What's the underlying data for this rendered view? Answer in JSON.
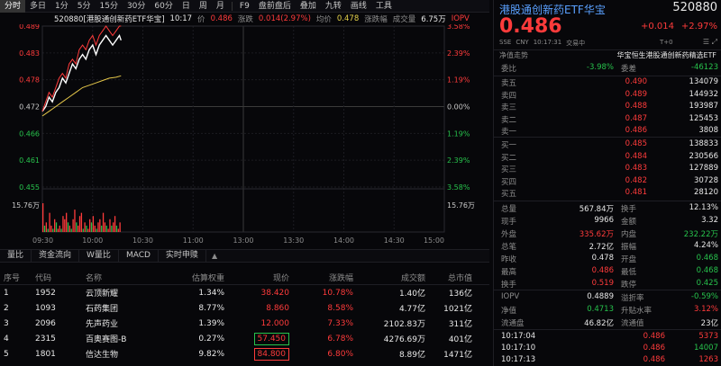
{
  "periods": [
    "分时",
    "多日",
    "1分",
    "5分",
    "15分",
    "30分",
    "60分",
    "日",
    "周",
    "月",
    "F9",
    "盘前盘后",
    "叠加",
    "九转",
    "画线",
    "工具"
  ],
  "info": {
    "code_name": "520880[港股通创新药ETF华宝]",
    "time": "10:17",
    "price_label": "价",
    "price": "0.486",
    "change_label": "涨跌",
    "change": "0.014(2.97%)",
    "avg_label": "均价",
    "avg": "0.478",
    "pct_label": "涨跌幅",
    "vol_label": "成交量",
    "volume": "6.75万",
    "iopv_label": "IOPV"
  },
  "chart": {
    "price_ticks": [
      "0.489",
      "0.483",
      "0.478",
      "0.472",
      "0.466",
      "0.461",
      "0.455"
    ],
    "pct_ticks": [
      "3.58%",
      "2.39%",
      "1.19%",
      "0.00%",
      "1.19%",
      "2.39%",
      "3.58%"
    ],
    "vol_ticks": [
      "15.76万",
      "15.76万"
    ],
    "time_ticks": [
      "09:30",
      "10:00",
      "10:30",
      "11:00",
      "13:00",
      "13:30",
      "14:00",
      "14:30",
      "15:00"
    ]
  },
  "chart_data": {
    "type": "line",
    "ylim": [
      0.455,
      0.489
    ],
    "series": [
      {
        "name": "价",
        "x": [
          0,
          2,
          4,
          6,
          8,
          10,
          12,
          14,
          16,
          18,
          20,
          22,
          24,
          26,
          28,
          30,
          32,
          34,
          36,
          38,
          40,
          42,
          44,
          46,
          47
        ],
        "values": [
          0.471,
          0.472,
          0.474,
          0.473,
          0.475,
          0.476,
          0.478,
          0.477,
          0.479,
          0.481,
          0.48,
          0.482,
          0.483,
          0.482,
          0.484,
          0.485,
          0.483,
          0.485,
          0.486,
          0.487,
          0.486,
          0.485,
          0.486,
          0.487,
          0.486
        ]
      },
      {
        "name": "均价",
        "x": [
          0,
          4,
          8,
          12,
          16,
          20,
          24,
          28,
          32,
          36,
          40,
          44,
          47
        ],
        "values": [
          0.47,
          0.471,
          0.472,
          0.473,
          0.474,
          0.475,
          0.476,
          0.4765,
          0.477,
          0.4775,
          0.478,
          0.4782,
          0.4785
        ]
      },
      {
        "name": "IOPV",
        "x": [
          0,
          2,
          4,
          6,
          8,
          10,
          12,
          14,
          16,
          18,
          20,
          22,
          24,
          26,
          28,
          30,
          32,
          34,
          36,
          38,
          40,
          42,
          44,
          46,
          47
        ],
        "values": [
          0.471,
          0.473,
          0.475,
          0.474,
          0.476,
          0.478,
          0.479,
          0.478,
          0.481,
          0.482,
          0.481,
          0.484,
          0.485,
          0.484,
          0.486,
          0.487,
          0.485,
          0.487,
          0.488,
          0.489,
          0.488,
          0.487,
          0.488,
          0.489,
          0.489
        ]
      }
    ],
    "volume": [
      9,
      2,
      3,
      1,
      6,
      2,
      1,
      4,
      3,
      1,
      2,
      1,
      5,
      4,
      6,
      3,
      2,
      1,
      4,
      7,
      3,
      2,
      5,
      6,
      1,
      3,
      2,
      1,
      4,
      3,
      5,
      2,
      1,
      3,
      4,
      2,
      6,
      3,
      2,
      1,
      4,
      2,
      3,
      5,
      2,
      1,
      3
    ],
    "volume_colors": [
      "r",
      "g",
      "r",
      "g",
      "r",
      "r",
      "g",
      "r",
      "g",
      "r",
      "r",
      "g",
      "r",
      "r",
      "r",
      "g",
      "r",
      "g",
      "r",
      "r",
      "g",
      "r",
      "r",
      "r",
      "g",
      "r",
      "g",
      "r",
      "r",
      "g",
      "r",
      "r",
      "g",
      "r",
      "r",
      "g",
      "r",
      "r",
      "g",
      "r",
      "r",
      "g",
      "r",
      "r",
      "g",
      "r",
      "r"
    ]
  },
  "tabs": [
    "量比",
    "资金流向",
    "W量比",
    "MACD",
    "实时申赎"
  ],
  "table": {
    "headers": [
      "序号",
      "代码",
      "名称",
      "估算权重",
      "现价",
      "涨跌幅",
      "成交额",
      "总市值"
    ],
    "rows": [
      {
        "idx": "1",
        "code": "1952",
        "name": "云顶新耀",
        "weight": "1.34%",
        "price": "38.420",
        "pct": "10.78%",
        "amount": "1.40亿",
        "cap": "136亿",
        "box": ""
      },
      {
        "idx": "2",
        "code": "1093",
        "name": "石药集团",
        "weight": "8.77%",
        "price": "8.860",
        "pct": "8.58%",
        "amount": "4.77亿",
        "cap": "1021亿",
        "box": ""
      },
      {
        "idx": "3",
        "code": "2096",
        "name": "先声药业",
        "weight": "1.39%",
        "price": "12.000",
        "pct": "7.33%",
        "amount": "2102.83万",
        "cap": "311亿",
        "box": ""
      },
      {
        "idx": "4",
        "code": "2315",
        "name": "百奥赛图-B",
        "weight": "0.27%",
        "price": "57.450",
        "pct": "6.78%",
        "amount": "4276.69万",
        "cap": "401亿",
        "box": "g"
      },
      {
        "idx": "5",
        "code": "1801",
        "name": "信达生物",
        "weight": "9.82%",
        "price": "84.800",
        "pct": "6.80%",
        "amount": "8.89亿",
        "cap": "1471亿",
        "box": "r"
      }
    ]
  },
  "panel": {
    "title": "港股通创新药ETF华宝",
    "code": "520880",
    "price": "0.486",
    "change": "+0.014",
    "pct": "+2.97%",
    "exchange": "SSE",
    "currency": "CNY",
    "time": "10:17:31",
    "status": "交易中",
    "t0": "T+0",
    "nav_label": "净值走势",
    "index_name": "华宝恒生港股通创新药精选ETF",
    "weibi_label": "委比",
    "weibi": "-3.98%",
    "weicha_label": "委差",
    "weicha": "-46123",
    "asks": [
      {
        "label": "卖五",
        "price": "0.490",
        "vol": "134079"
      },
      {
        "label": "卖四",
        "price": "0.489",
        "vol": "144932"
      },
      {
        "label": "卖三",
        "price": "0.488",
        "vol": "193987"
      },
      {
        "label": "卖二",
        "price": "0.487",
        "vol": "125453"
      },
      {
        "label": "卖一",
        "price": "0.486",
        "vol": "3808"
      }
    ],
    "bids": [
      {
        "label": "买一",
        "price": "0.485",
        "vol": "138833"
      },
      {
        "label": "买二",
        "price": "0.484",
        "vol": "230566"
      },
      {
        "label": "买三",
        "price": "0.483",
        "vol": "127889"
      },
      {
        "label": "买四",
        "price": "0.482",
        "vol": "30728"
      },
      {
        "label": "买五",
        "price": "0.481",
        "vol": "28120"
      }
    ],
    "stats": [
      {
        "a": "总量",
        "av": "567.84万",
        "ac": "white",
        "b": "换手",
        "bv": "12.13%",
        "bc": "white"
      },
      {
        "a": "现手",
        "av": "9966",
        "ac": "white",
        "b": "金额",
        "bv": "3.32",
        "bc": "white"
      },
      {
        "a": "外盘",
        "av": "335.62万",
        "ac": "red",
        "b": "内盘",
        "bv": "232.22万",
        "bc": "green"
      },
      {
        "a": "总笔",
        "av": "2.72亿",
        "ac": "white",
        "b": "振幅",
        "bv": "4.24%",
        "bc": "white"
      },
      {
        "a": "昨收",
        "av": "0.478",
        "ac": "white",
        "b": "开盘",
        "bv": "0.468",
        "bc": "green"
      },
      {
        "a": "最高",
        "av": "0.486",
        "ac": "red",
        "b": "最低",
        "bv": "0.468",
        "bc": "green"
      },
      {
        "a": "换手",
        "av": "0.519",
        "ac": "red",
        "b": "跌停",
        "bv": "0.425",
        "bc": "green"
      }
    ],
    "extra": [
      {
        "a": "IOPV",
        "av": "0.4889",
        "ac": "white",
        "b": "溢折率",
        "bv": "-0.59%",
        "bc": "green"
      },
      {
        "a": "净值",
        "av": "0.4713",
        "ac": "green",
        "b": "升贴水率",
        "bv": "3.12%",
        "bc": "red"
      },
      {
        "a": "流通盘",
        "av": "46.82亿",
        "ac": "white",
        "b": "流通值",
        "bv": "23亿",
        "bc": "white"
      }
    ],
    "ticks": [
      {
        "time": "10:17:04",
        "price": "0.486",
        "vol": "5373",
        "vc": "red"
      },
      {
        "time": "10:17:10",
        "price": "0.486",
        "vol": "14007",
        "vc": "green"
      },
      {
        "time": "10:17:13",
        "price": "0.486",
        "vol": "1263",
        "vc": "red"
      }
    ]
  }
}
